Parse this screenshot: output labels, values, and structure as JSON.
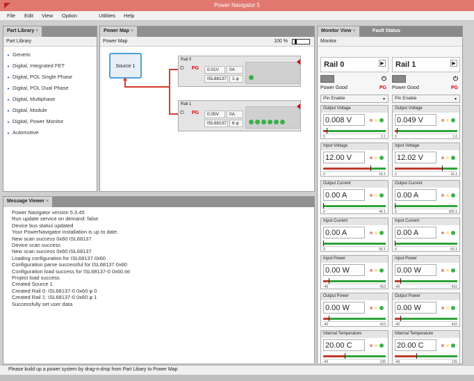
{
  "window": {
    "title": "Power Navigator 5"
  },
  "menu": [
    "File",
    "Edit",
    "View",
    "Option",
    "Utilities",
    "Help"
  ],
  "part_library": {
    "tab": "Part Library",
    "header": "Part Library",
    "items": [
      "Generic",
      "Digital, Integrated FET",
      "Digital, POL Single Phase",
      "Digital, POL Dual Phase",
      "Digital, Multiphase",
      "Digital, Module",
      "Digital, Power Monitor",
      "Automotive"
    ]
  },
  "power_map": {
    "tab": "Power Map",
    "header": "Power Map",
    "zoom": "100 %",
    "source_label": "Source 1",
    "rails": [
      {
        "name": "Rail 0",
        "pg": "PG",
        "voltage": "0.01V",
        "current": "0A",
        "part": "ISL68137",
        "phase": "1 φ"
      },
      {
        "name": "Rail 1",
        "pg": "PG",
        "voltage": "0.05V",
        "current": "0A",
        "part": "ISL68137",
        "phase": "6 φ"
      }
    ]
  },
  "message_viewer": {
    "tab": "Message Viewer",
    "lines": [
      "Power Navigator version 5.3.45",
      "Run update service on demand: false",
      "Device bus status updated",
      "Your PowerNavigator installation is up to date.",
      "New scan success 0x60  ISL68137",
      "Device scan success",
      "New scan success 0x60  ISL68137",
      "Loading configuration for ISL68137 0x60",
      "Configuration parse successful for ISL68137 0x60",
      "Configuration load success for ISL68137-0 0x60.txt",
      "Project load success",
      "Created Source 1",
      "Created Rail 0: ISL68137-0 0x60 φ 0",
      "Created Rail 1: ISL68137-0 0x60 φ 1",
      "Successfully set user data"
    ]
  },
  "monitor": {
    "tab": "Monitor View",
    "tab2": "Fault Status",
    "header": "Monitor",
    "rails": [
      {
        "name": "Rail 0",
        "power_good": "Power Good",
        "pg": "PG",
        "pin": "Pin Enable",
        "meters": [
          {
            "title": "Output Voltage",
            "value": "0.008 V",
            "lo": "0",
            "hi": "2.1",
            "level": 0.05
          },
          {
            "title": "Input Voltage",
            "value": "12.00 V",
            "lo": "0",
            "hi": "16.1",
            "level": 0.75
          },
          {
            "title": "Output Current",
            "value": "0.00 A",
            "lo": "0",
            "hi": "40.1",
            "level": 0.0
          },
          {
            "title": "Input Current",
            "value": "0.00 A",
            "lo": "0",
            "hi": "50.1",
            "level": 0.0
          },
          {
            "title": "Input Power",
            "value": "0.00 W",
            "lo": "-40",
            "hi": "410",
            "level": 0.09
          },
          {
            "title": "Output Power",
            "value": "0.00 W",
            "lo": "-40",
            "hi": "410",
            "level": 0.09
          },
          {
            "title": "Internal Temperature",
            "value": "20.00 C",
            "lo": "-40",
            "hi": "135",
            "level": 0.34
          }
        ]
      },
      {
        "name": "Rail 1",
        "power_good": "Power Good",
        "pg": "PG",
        "pin": "Pin Enable",
        "meters": [
          {
            "title": "Output Voltage",
            "value": "0.049 V",
            "lo": "0",
            "hi": "1.6",
            "level": 0.03
          },
          {
            "title": "Input Voltage",
            "value": "12.02 V",
            "lo": "0",
            "hi": "16.1",
            "level": 0.75
          },
          {
            "title": "Output Current",
            "value": "0.00 A",
            "lo": "0",
            "hi": "300.1",
            "level": 0.0
          },
          {
            "title": "Input Current",
            "value": "0.00 A",
            "lo": "0",
            "hi": "50.1",
            "level": 0.0
          },
          {
            "title": "Input Power",
            "value": "0.00 W",
            "lo": "-40",
            "hi": "410",
            "level": 0.09
          },
          {
            "title": "Output Power",
            "value": "0.00 W",
            "lo": "-40",
            "hi": "410",
            "level": 0.09
          },
          {
            "title": "Internal Temperature",
            "value": "20.00 C",
            "lo": "-40",
            "hi": "135",
            "level": 0.34
          }
        ]
      }
    ]
  },
  "status_bar": "Please build up a power system by drag-n-drop from Part Libary to Power Map"
}
